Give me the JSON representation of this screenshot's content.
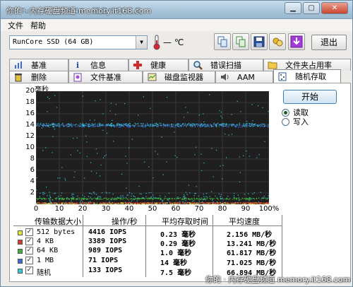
{
  "window": {
    "title": "HD Tune 专业版 4.50 - 硬盘/SSD工具",
    "title_watermark": "你的 · 内存硬盘频道 memory.it168.com"
  },
  "menu": {
    "items": [
      "文件",
      "帮助"
    ]
  },
  "toolbar": {
    "drive": "RunCore SSD (64 GB)",
    "temperature": "— ℃",
    "exit_label": "退出",
    "icons": [
      "copy-icon",
      "copy-info-icon",
      "save-icon",
      "options-icon",
      "download-icon"
    ]
  },
  "tabs": {
    "row1": [
      "基准",
      "信息",
      "健康",
      "错误扫描",
      "文件夹占用率"
    ],
    "row2": [
      "删除",
      "文件基准",
      "磁盘监视器",
      "AAM",
      "随机存取"
    ],
    "active": "随机存取"
  },
  "controls": {
    "start_label": "开始",
    "modes": [
      {
        "label": "读取",
        "selected": true
      },
      {
        "label": "写入",
        "selected": false
      }
    ]
  },
  "chart_data": {
    "type": "scatter",
    "ylabel": "毫秒",
    "ylim": [
      0,
      20
    ],
    "yticks": [
      "20",
      "18",
      "16",
      "14",
      "12",
      "10",
      "8",
      "6",
      "4",
      "2"
    ],
    "xlim": [
      0,
      100
    ],
    "xticks": [
      "0",
      "10",
      "20",
      "30",
      "40",
      "50",
      "60",
      "70",
      "80",
      "90",
      "100%"
    ],
    "grid": true,
    "series": [
      {
        "name": "512 bytes",
        "color": "#e8e23a",
        "band_ms": [
          0.1,
          0.35
        ]
      },
      {
        "name": "4 KB",
        "color": "#d13a2e",
        "band_ms": [
          0.2,
          0.4
        ]
      },
      {
        "name": "64 KB",
        "color": "#3fae3b",
        "band_ms": [
          0.9,
          1.2
        ]
      },
      {
        "name": "1 MB",
        "color": "#3a6ad6",
        "band_ms": [
          13.7,
          14.3
        ]
      },
      {
        "name": "随机",
        "color": "#35c6d8",
        "band_ms": [
          0,
          19.5
        ]
      }
    ]
  },
  "table": {
    "headers": [
      "传输数据大小",
      "操作/秒",
      "平均存取时间",
      "平均速度"
    ],
    "rows": [
      {
        "color": "#e8e23a",
        "checked": true,
        "size": "512 bytes",
        "ops": "4416 IOPS",
        "access": "0.23 毫秒",
        "speed": "2.156 MB/秒"
      },
      {
        "color": "#d13a2e",
        "checked": true,
        "size": "4 KB",
        "ops": "3389 IOPS",
        "access": "0.29 毫秒",
        "speed": "13.241 MB/秒"
      },
      {
        "color": "#3fae3b",
        "checked": true,
        "size": "64 KB",
        "ops": "989 IOPS",
        "access": "1.0 毫秒",
        "speed": "61.817 MB/秒"
      },
      {
        "color": "#3a6ad6",
        "checked": true,
        "size": "1 MB",
        "ops": "71 IOPS",
        "access": "14 毫秒",
        "speed": "71.025 MB/秒"
      },
      {
        "color": "#35c6d8",
        "checked": true,
        "size": "随机",
        "ops": "133 IOPS",
        "access": "7.5 毫秒",
        "speed": "66.894 MB/秒"
      }
    ]
  },
  "watermark": "你的 · 内存硬盘频道 memory.it168.com"
}
